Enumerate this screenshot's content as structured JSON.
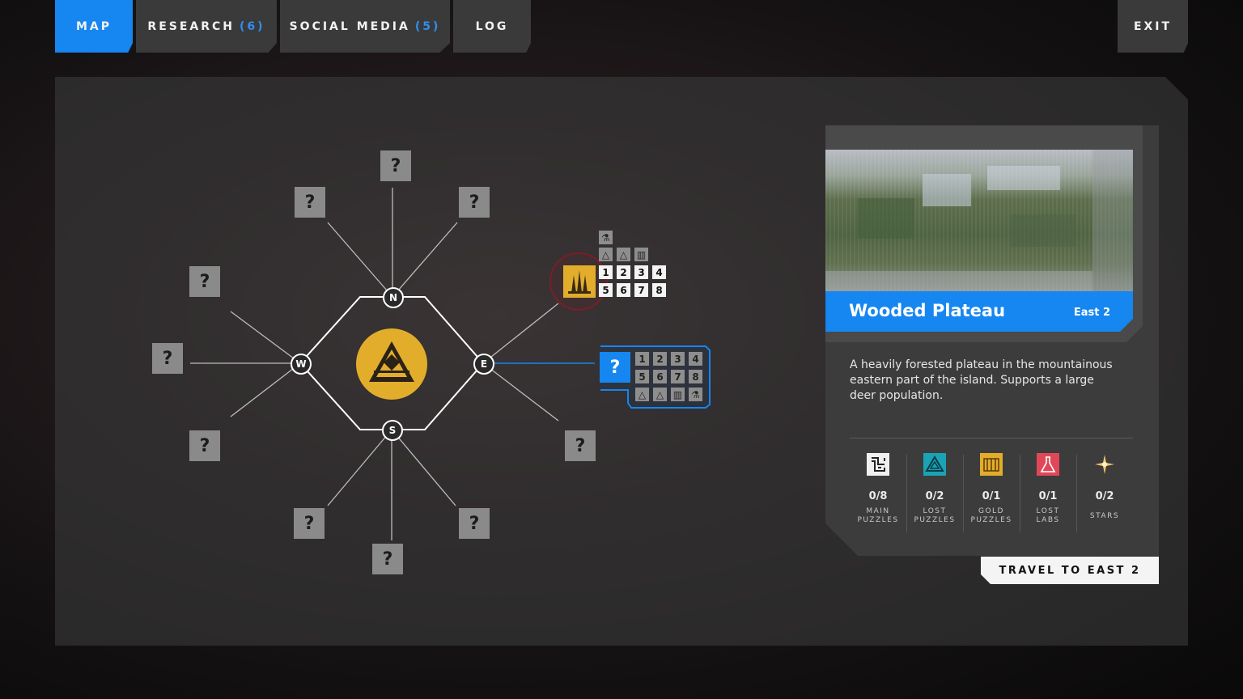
{
  "tabs": {
    "map": "MAP",
    "research": "RESEARCH",
    "research_count": "(6)",
    "social": "SOCIAL MEDIA",
    "social_count": "(5)",
    "log": "LOG",
    "exit": "EXIT"
  },
  "map": {
    "unknown_label": "?",
    "compass": {
      "n": "N",
      "s": "S",
      "e": "E",
      "w": "W"
    },
    "discovered_region": {
      "puzzle_numbers": [
        "1",
        "2",
        "3",
        "4",
        "5",
        "6",
        "7",
        "8"
      ],
      "icon": "temple-spires-icon"
    },
    "selected_region": {
      "label": "?",
      "puzzle_numbers": [
        "1",
        "2",
        "3",
        "4",
        "5",
        "6",
        "7",
        "8"
      ]
    },
    "center_icon": "pyramid-emblem-icon"
  },
  "colors": {
    "accent": "#1686f0",
    "gold": "#e3ad2c",
    "lost_puzzle": "#1aa3b5",
    "lost_lab": "#e0485a"
  },
  "region": {
    "name": "Wooded Plateau",
    "code": "East 2",
    "description": "A heavily forested plateau in the mountainous eastern part of the island. Supports a large deer population.",
    "stats": [
      {
        "icon": "maze-icon",
        "value": "0/8",
        "label1": "MAIN",
        "label2": "PUZZLES"
      },
      {
        "icon": "triangle-icon",
        "value": "0/2",
        "label1": "LOST",
        "label2": "PUZZLES"
      },
      {
        "icon": "gate-icon",
        "value": "0/1",
        "label1": "GOLD",
        "label2": "PUZZLES"
      },
      {
        "icon": "flask-icon",
        "value": "0/1",
        "label1": "LOST",
        "label2": "LABS"
      },
      {
        "icon": "star-icon",
        "value": "0/2",
        "label1": "STARS",
        "label2": ""
      }
    ],
    "travel_button": "TRAVEL TO EAST 2"
  }
}
